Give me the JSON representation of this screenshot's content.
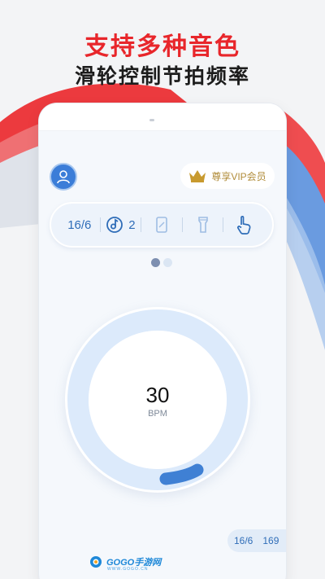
{
  "promo": {
    "headline": "支持多种音色",
    "subheadline": "滑轮控制节拍频率"
  },
  "colors": {
    "headline": "#e8262b",
    "accent": "#3b7dd8",
    "vip_gold": "#b18c3a"
  },
  "header": {
    "avatar_icon": "user-icon",
    "vip_icon": "crown-icon",
    "vip_label": "尊享VIP会员"
  },
  "toolbar": {
    "time_signature": "16/6",
    "sound_icon": "note-disc-icon",
    "sound_count": "2",
    "items": [
      "phone-vibrate-icon",
      "flashlight-icon",
      "tap-hand-icon"
    ]
  },
  "pager": {
    "pages": 2,
    "active_index": 0
  },
  "metronome": {
    "tempo": "30",
    "unit": "BPM"
  },
  "footer": {
    "time_signature": "16/6",
    "value": "169"
  },
  "watermark": {
    "logo_text": "GOGO手游网",
    "domain": "WWW.GOGO.CN"
  }
}
